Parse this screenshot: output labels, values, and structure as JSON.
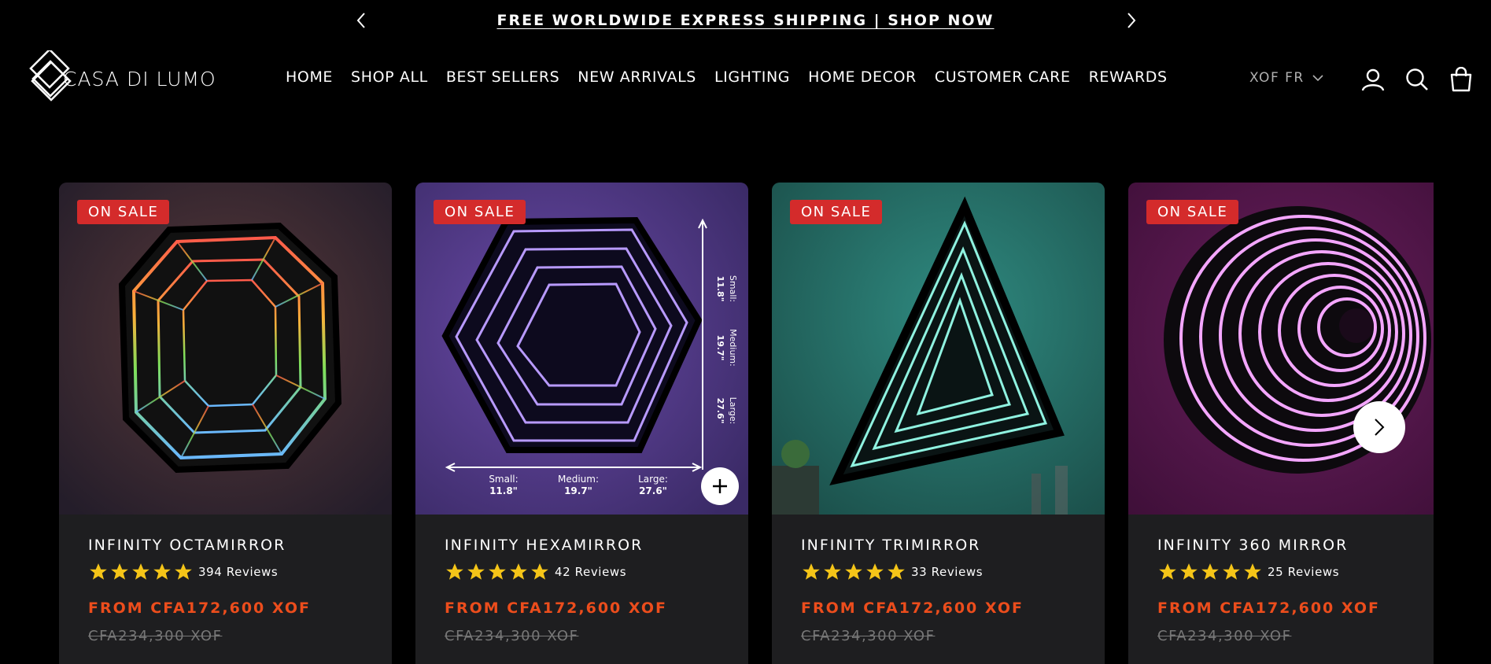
{
  "announcement": {
    "text": "FREE WORLDWIDE EXPRESS SHIPPING | SHOP NOW",
    "prev_icon": "chevron-left-icon",
    "next_icon": "chevron-right-icon"
  },
  "brand": {
    "name": "CASA DI LUMO"
  },
  "nav": {
    "items": [
      "HOME",
      "SHOP ALL",
      "BEST SELLERS",
      "NEW ARRIVALS",
      "LIGHTING",
      "HOME DECOR",
      "CUSTOMER CARE",
      "REWARDS"
    ]
  },
  "locale": {
    "label": "XOF FR",
    "icon": "chevron-down-icon"
  },
  "header_icons": [
    "account-icon",
    "search-icon",
    "cart-icon"
  ],
  "colors": {
    "sale_badge": "#d42b2b",
    "price": "#ec4d1c",
    "star": "#f5c518",
    "card_bg": "#1e1e20"
  },
  "products": [
    {
      "badge": "ON SALE",
      "name": "INFINITY OCTAMIRROR",
      "rating": 5,
      "reviews": "394 Reviews",
      "price": "FROM CFA172,600 XOF",
      "compare_price": "CFA234,300 XOF"
    },
    {
      "badge": "ON SALE",
      "name": "INFINITY HEXAMIRROR",
      "rating": 5,
      "reviews": "42 Reviews",
      "price": "FROM CFA172,600 XOF",
      "compare_price": "CFA234,300 XOF",
      "size_labels": {
        "small": "Small:",
        "small_val": "11.8\"",
        "medium": "Medium:",
        "medium_val": "19.7\"",
        "large": "Large:",
        "large_val": "27.6\""
      }
    },
    {
      "badge": "ON SALE",
      "name": "INFINITY TRIMIRROR",
      "rating": 5,
      "reviews": "33 Reviews",
      "price": "FROM CFA172,600 XOF",
      "compare_price": "CFA234,300 XOF"
    },
    {
      "badge": "ON SALE",
      "name": "INFINITY 360 MIRROR",
      "rating": 5,
      "reviews": "25 Reviews",
      "price": "FROM CFA172,600 XOF",
      "compare_price": "CFA234,300 XOF"
    }
  ]
}
